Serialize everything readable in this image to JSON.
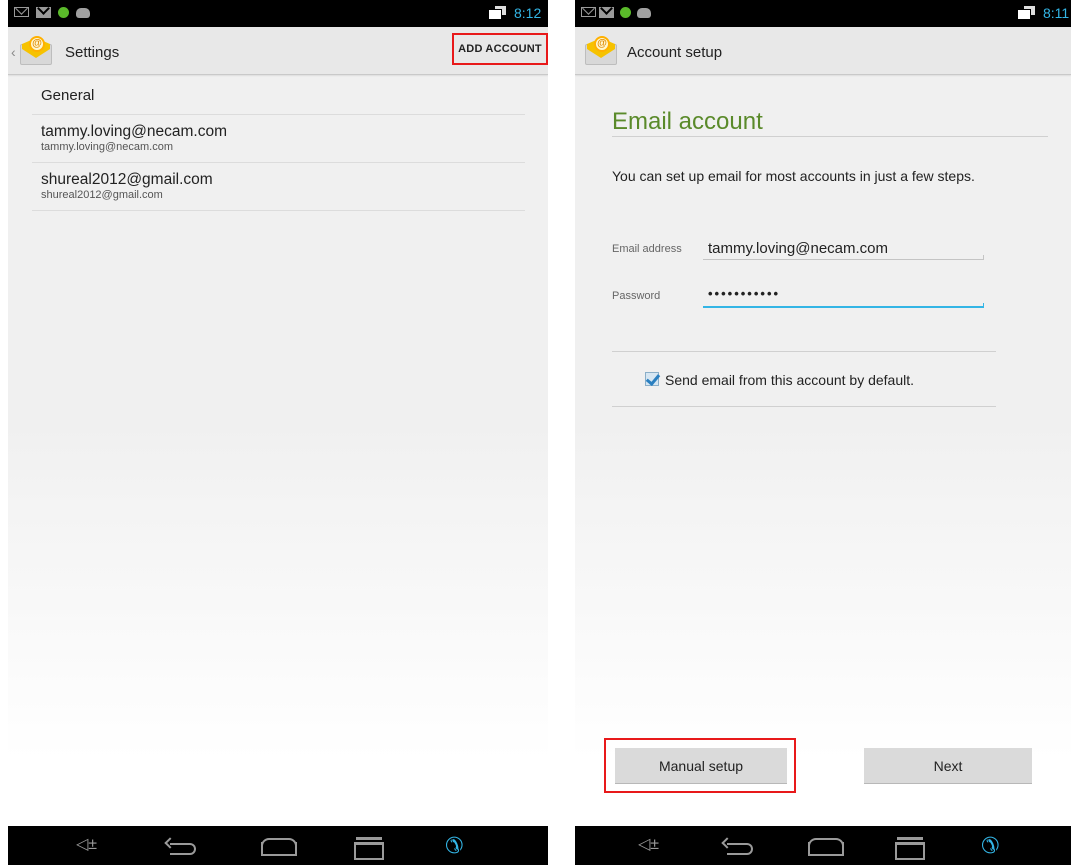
{
  "left_screen": {
    "status_bar": {
      "time": "8:12"
    },
    "action_bar": {
      "title": "Settings",
      "add_account_label": "ADD ACCOUNT"
    },
    "list": {
      "general_label": "General",
      "accounts": [
        {
          "name": "tammy.loving@necam.com",
          "email": "tammy.loving@necam.com"
        },
        {
          "name": "shureal2012@gmail.com",
          "email": "shureal2012@gmail.com"
        }
      ]
    }
  },
  "right_screen": {
    "status_bar": {
      "time": "8:11"
    },
    "action_bar": {
      "title": "Account setup"
    },
    "heading": "Email account",
    "intro": "You can set up email for most accounts in just a few steps.",
    "email_label": "Email address",
    "email_value": "tammy.loving@necam.com",
    "password_label": "Password",
    "password_value": "•••••••••••",
    "default_checkbox": {
      "label": "Send email from this account by default.",
      "checked": true
    },
    "manual_setup_label": "Manual setup",
    "next_label": "Next"
  },
  "nav_icons": [
    "volume-icon",
    "back-icon",
    "home-icon",
    "recent-apps-icon",
    "phone-icon"
  ],
  "colors": {
    "accent_blue": "#33b5e5",
    "heading_green": "#5a8a2a",
    "highlight_red": "#e8191a"
  }
}
